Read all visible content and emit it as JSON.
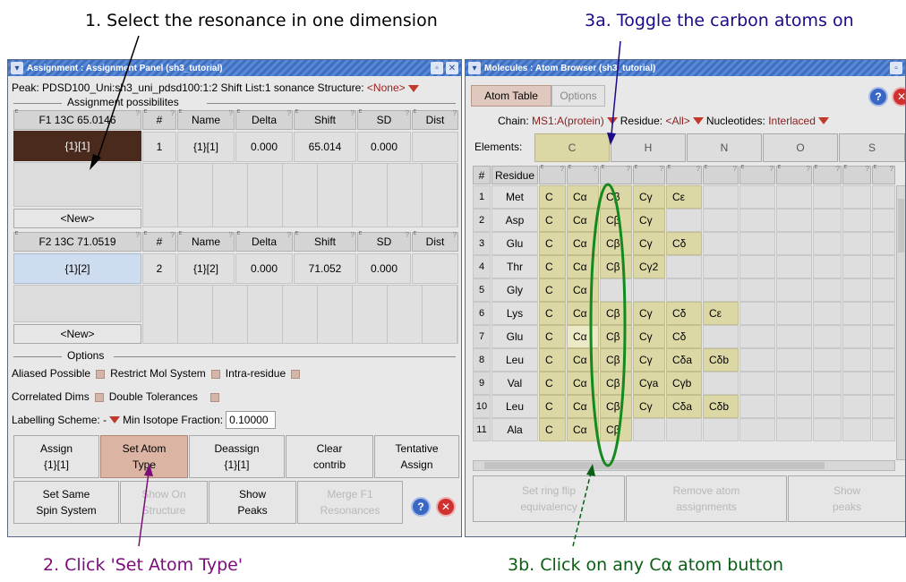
{
  "callouts": {
    "step1": "1. Select the resonance in one dimension",
    "step2": "2. Click 'Set Atom Type'",
    "step3a": "3a. Toggle the carbon atoms on",
    "step3b": "3b. Click on any Cα atom button"
  },
  "assignment": {
    "title": "Assignment : Assignment Panel (sh3_tutorial)",
    "peak_line": "Peak: PDSD100_Uni:sh3_uni_pdsd100:1:2 Shift List:1 sonance  Structure: ",
    "structure_value": "<None>",
    "possibilities_label": "Assignment possibilites",
    "headers": [
      "#",
      "Name",
      "Delta",
      "Shift",
      "SD",
      "Dist"
    ],
    "dim1": {
      "label": "F1 13C  65.0146",
      "resonance": "{1}[1]",
      "new_label": "<New>",
      "row": {
        "num": "1",
        "name": "{1}[1]",
        "delta": "0.000",
        "shift": "65.014",
        "sd": "0.000",
        "dist": ""
      }
    },
    "dim2": {
      "label": "F2 13C  71.0519",
      "resonance": "{1}[2]",
      "new_label": "<New>",
      "row": {
        "num": "2",
        "name": "{1}[2]",
        "delta": "0.000",
        "shift": "71.052",
        "sd": "0.000",
        "dist": ""
      }
    },
    "options_label": "Options",
    "opt_aliased": "Aliased Possible",
    "opt_restrict": "Restrict Mol System",
    "opt_intra": "Intra-residue",
    "opt_correlated": "Correlated Dims",
    "opt_double": "Double Tolerances",
    "labelling_label": "Labelling Scheme: -",
    "min_isotope_label": "Min Isotope Fraction:",
    "min_isotope_value": "0.10000",
    "buttons_row1": [
      {
        "l1": "Assign",
        "l2": "{1}[1]"
      },
      {
        "l1": "Set Atom",
        "l2": "Type"
      },
      {
        "l1": "Deassign",
        "l2": "{1}[1]"
      },
      {
        "l1": "Clear",
        "l2": "contrib"
      },
      {
        "l1": "Tentative",
        "l2": "Assign"
      }
    ],
    "buttons_row2": [
      {
        "l1": "Set Same",
        "l2": "Spin System"
      },
      {
        "l1": "Show On",
        "l2": "Structure"
      },
      {
        "l1": "Show",
        "l2": "Peaks"
      },
      {
        "l1": "Merge F1",
        "l2": "Resonances"
      }
    ]
  },
  "browser": {
    "title": "Molecules : Atom Browser (sh3_tutorial)",
    "tabs": [
      "Atom Table",
      "Options"
    ],
    "chain_label": "Chain:",
    "chain_value": "MS1:A(protein)",
    "residue_label": "Residue:",
    "residue_value": "<All>",
    "nucleotides_label": "Nucleotides:",
    "nucleotides_value": "Interlaced",
    "elements_label": "Elements:",
    "elements": [
      "C",
      "H",
      "N",
      "O",
      "S"
    ],
    "col_num": "#",
    "col_residue": "Residue",
    "rows": [
      {
        "n": "1",
        "res": "Met",
        "atoms": [
          "C",
          "Cα",
          "Cβ",
          "Cγ",
          "Cε"
        ]
      },
      {
        "n": "2",
        "res": "Asp",
        "atoms": [
          "C",
          "Cα",
          "Cβ",
          "Cγ"
        ]
      },
      {
        "n": "3",
        "res": "Glu",
        "atoms": [
          "C",
          "Cα",
          "Cβ",
          "Cγ",
          "Cδ"
        ]
      },
      {
        "n": "4",
        "res": "Thr",
        "atoms": [
          "C",
          "Cα",
          "Cβ",
          "Cγ2"
        ]
      },
      {
        "n": "5",
        "res": "Gly",
        "atoms": [
          "C",
          "Cα"
        ]
      },
      {
        "n": "6",
        "res": "Lys",
        "atoms": [
          "C",
          "Cα",
          "Cβ",
          "Cγ",
          "Cδ",
          "Cε"
        ]
      },
      {
        "n": "7",
        "res": "Glu",
        "atoms": [
          "C",
          "Cα",
          "Cβ",
          "Cγ",
          "Cδ"
        ]
      },
      {
        "n": "8",
        "res": "Leu",
        "atoms": [
          "C",
          "Cα",
          "Cβ",
          "Cγ",
          "Cδa",
          "Cδb"
        ]
      },
      {
        "n": "9",
        "res": "Val",
        "atoms": [
          "C",
          "Cα",
          "Cβ",
          "Cγa",
          "Cγb"
        ]
      },
      {
        "n": "10",
        "res": "Leu",
        "atoms": [
          "C",
          "Cα",
          "Cβ",
          "Cγ",
          "Cδa",
          "Cδb"
        ]
      },
      {
        "n": "11",
        "res": "Ala",
        "atoms": [
          "C",
          "Cα",
          "Cβ"
        ]
      }
    ],
    "bottom_buttons": [
      {
        "l1": "Set ring flip",
        "l2": "equivalency"
      },
      {
        "l1": "Remove atom",
        "l2": "assignments"
      },
      {
        "l1": "Show",
        "l2": "peaks"
      }
    ]
  }
}
